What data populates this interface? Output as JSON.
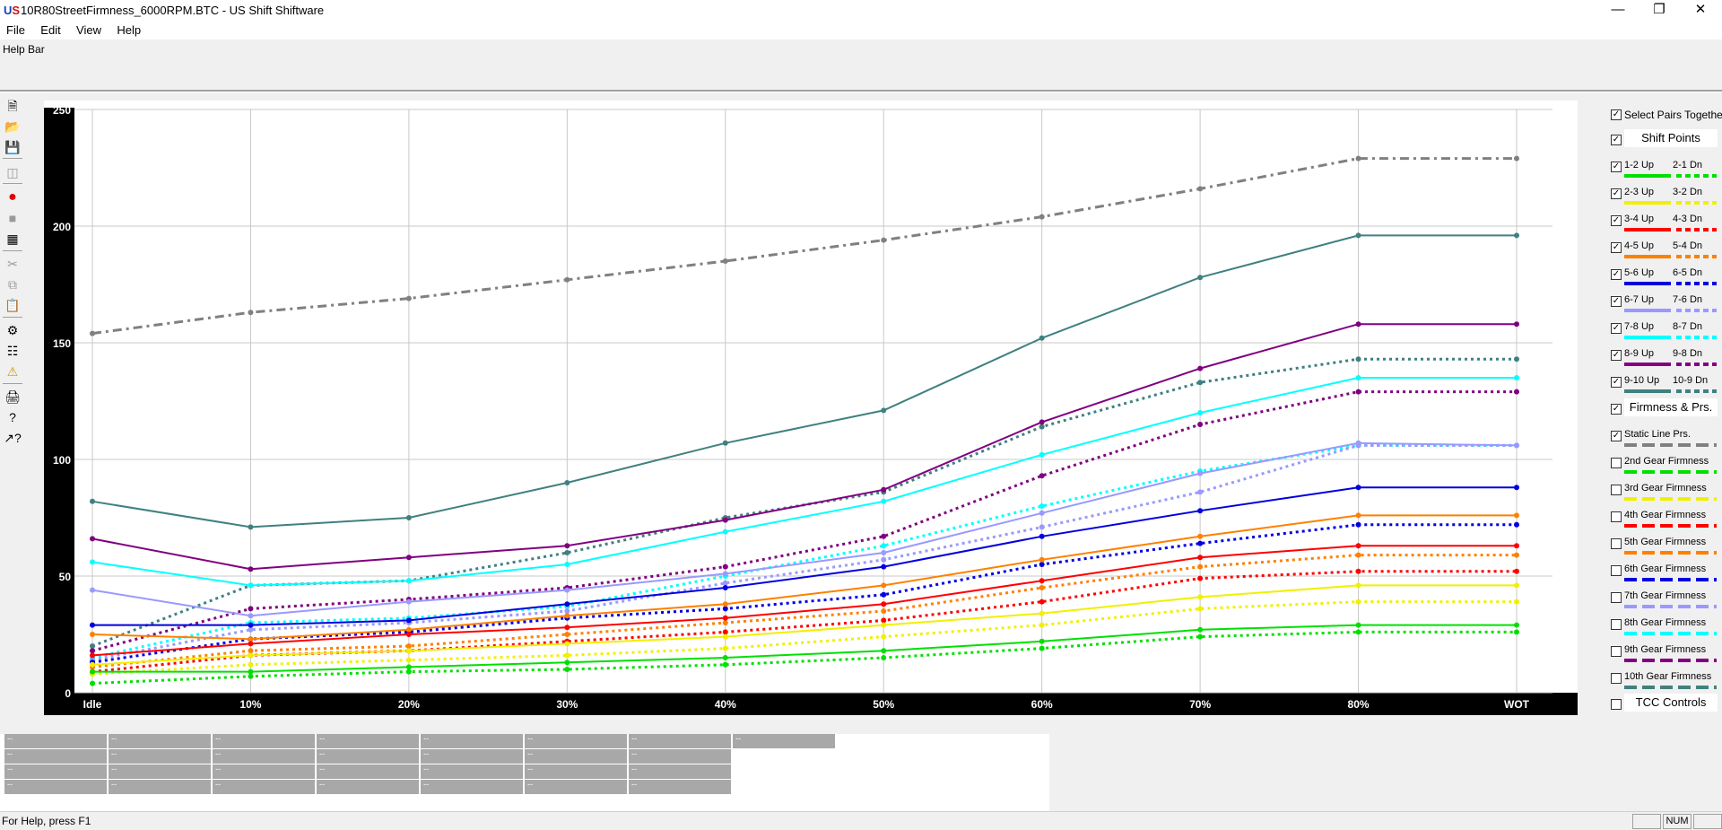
{
  "app": {
    "icon_text": "US",
    "title": "10R80StreetFirmness_6000RPM.BTC - US Shift Shiftware"
  },
  "menu": [
    "File",
    "Edit",
    "View",
    "Help"
  ],
  "help_bar_label": "Help Bar",
  "status": {
    "text": "For Help, press F1",
    "num": "NUM"
  },
  "right_panel": {
    "select_pairs": "Select Pairs Together",
    "shift_points_btn": "Shift Points",
    "pairs": [
      {
        "up": "1-2 Up",
        "dn": "2-1 Dn",
        "color": "#00e000",
        "checked": true
      },
      {
        "up": "2-3 Up",
        "dn": "3-2 Dn",
        "color": "#f0f000",
        "checked": true
      },
      {
        "up": "3-4 Up",
        "dn": "4-3 Dn",
        "color": "#ff0000",
        "checked": true
      },
      {
        "up": "4-5 Up",
        "dn": "5-4 Dn",
        "color": "#ff8000",
        "checked": true
      },
      {
        "up": "5-6 Up",
        "dn": "6-5 Dn",
        "color": "#0000e0",
        "checked": true
      },
      {
        "up": "6-7 Up",
        "dn": "7-6 Dn",
        "color": "#9999ff",
        "checked": true
      },
      {
        "up": "7-8 Up",
        "dn": "8-7 Dn",
        "color": "#00ffff",
        "checked": true
      },
      {
        "up": "8-9 Up",
        "dn": "9-8 Dn",
        "color": "#800080",
        "checked": true
      },
      {
        "up": "9-10 Up",
        "dn": "10-9 Dn",
        "color": "#408080",
        "checked": true
      }
    ],
    "firmness_btn": "Firmness & Prs.",
    "firmness_items": [
      {
        "label": "Static Line Prs.",
        "color": "#808080",
        "checked": true
      },
      {
        "label": "2nd Gear Firmness",
        "color": "#00e000",
        "checked": false
      },
      {
        "label": "3rd Gear Firmness",
        "color": "#f0f000",
        "checked": false
      },
      {
        "label": "4th Gear Firmness",
        "color": "#ff0000",
        "checked": false
      },
      {
        "label": "5th Gear Firmness",
        "color": "#ff8000",
        "checked": false
      },
      {
        "label": "6th Gear Firmness",
        "color": "#0000e0",
        "checked": false
      },
      {
        "label": "7th Gear Firmness",
        "color": "#9999ff",
        "checked": false
      },
      {
        "label": "8th Gear Firmness",
        "color": "#00ffff",
        "checked": false
      },
      {
        "label": "9th Gear Firmness",
        "color": "#800080",
        "checked": false
      },
      {
        "label": "10th Gear Firmness",
        "color": "#408080",
        "checked": false
      }
    ],
    "tcc_btn": "TCC Controls"
  },
  "grid": {
    "cell_text": "--",
    "rows": [
      8,
      7,
      7,
      7
    ]
  },
  "chart_data": {
    "type": "line",
    "categories": [
      "Idle",
      "10%",
      "20%",
      "30%",
      "40%",
      "50%",
      "60%",
      "70%",
      "80%",
      "WOT"
    ],
    "ylim": [
      0,
      250
    ],
    "yticks": [
      0,
      50,
      100,
      150,
      200,
      250
    ],
    "grid": true,
    "series": [
      {
        "name": "Static Line Prs.",
        "color": "#808080",
        "style": "dashdot",
        "values": [
          154,
          163,
          169,
          177,
          185,
          194,
          204,
          216,
          229,
          229
        ]
      },
      {
        "name": "9-10 Up",
        "color": "#408080",
        "style": "solid",
        "values": [
          82,
          71,
          75,
          90,
          107,
          121,
          152,
          178,
          196,
          196
        ]
      },
      {
        "name": "10-9 Dn",
        "color": "#408080",
        "style": "dotted",
        "values": [
          20,
          46,
          48,
          60,
          75,
          86,
          114,
          133,
          143,
          143
        ]
      },
      {
        "name": "8-9 Up",
        "color": "#800080",
        "style": "solid",
        "values": [
          66,
          53,
          58,
          63,
          74,
          87,
          116,
          139,
          158,
          158
        ]
      },
      {
        "name": "9-8 Dn",
        "color": "#800080",
        "style": "dotted",
        "values": [
          18,
          36,
          40,
          45,
          54,
          67,
          93,
          115,
          129,
          129
        ]
      },
      {
        "name": "7-8 Up",
        "color": "#00ffff",
        "style": "solid",
        "values": [
          56,
          46,
          48,
          55,
          69,
          82,
          102,
          120,
          135,
          135
        ]
      },
      {
        "name": "8-7 Dn",
        "color": "#00ffff",
        "style": "dotted",
        "values": [
          15,
          30,
          32,
          37,
          50,
          63,
          80,
          95,
          106,
          106
        ]
      },
      {
        "name": "6-7 Up",
        "color": "#9999ff",
        "style": "solid",
        "values": [
          44,
          33,
          39,
          44,
          51,
          60,
          77,
          94,
          107,
          106
        ]
      },
      {
        "name": "7-6 Dn",
        "color": "#9999ff",
        "style": "dotted",
        "values": [
          14,
          27,
          30,
          35,
          47,
          57,
          71,
          86,
          106,
          106
        ]
      },
      {
        "name": "5-6 Up",
        "color": "#0000e0",
        "style": "solid",
        "values": [
          29,
          29,
          31,
          38,
          45,
          54,
          67,
          78,
          88,
          88
        ]
      },
      {
        "name": "6-5 Dn",
        "color": "#0000e0",
        "style": "dotted",
        "values": [
          13,
          23,
          26,
          32,
          36,
          42,
          55,
          64,
          72,
          72
        ]
      },
      {
        "name": "4-5 Up",
        "color": "#ff8000",
        "style": "solid",
        "values": [
          25,
          23,
          27,
          33,
          38,
          46,
          57,
          67,
          76,
          76
        ]
      },
      {
        "name": "5-4 Dn",
        "color": "#ff8000",
        "style": "dotted",
        "values": [
          11,
          18,
          20,
          25,
          30,
          35,
          45,
          54,
          59,
          59
        ]
      },
      {
        "name": "3-4 Up",
        "color": "#ff0000",
        "style": "solid",
        "values": [
          16,
          21,
          25,
          28,
          32,
          38,
          48,
          58,
          63,
          63
        ]
      },
      {
        "name": "4-3 Dn",
        "color": "#ff0000",
        "style": "dotted",
        "values": [
          9,
          16,
          18,
          22,
          26,
          31,
          39,
          49,
          52,
          52
        ]
      },
      {
        "name": "2-3 Up",
        "color": "#f0f000",
        "style": "solid",
        "values": [
          12,
          16,
          18,
          21,
          24,
          29,
          34,
          41,
          46,
          46
        ]
      },
      {
        "name": "3-2 Dn",
        "color": "#f0f000",
        "style": "dotted",
        "values": [
          8,
          12,
          14,
          16,
          19,
          24,
          29,
          36,
          39,
          39
        ]
      },
      {
        "name": "1-2 Up",
        "color": "#00e000",
        "style": "solid",
        "values": [
          9,
          9,
          11,
          13,
          15,
          18,
          22,
          27,
          29,
          29
        ]
      },
      {
        "name": "2-1 Dn",
        "color": "#00e000",
        "style": "dotted",
        "values": [
          4,
          7,
          9,
          10,
          12,
          15,
          19,
          24,
          26,
          26
        ]
      }
    ]
  }
}
